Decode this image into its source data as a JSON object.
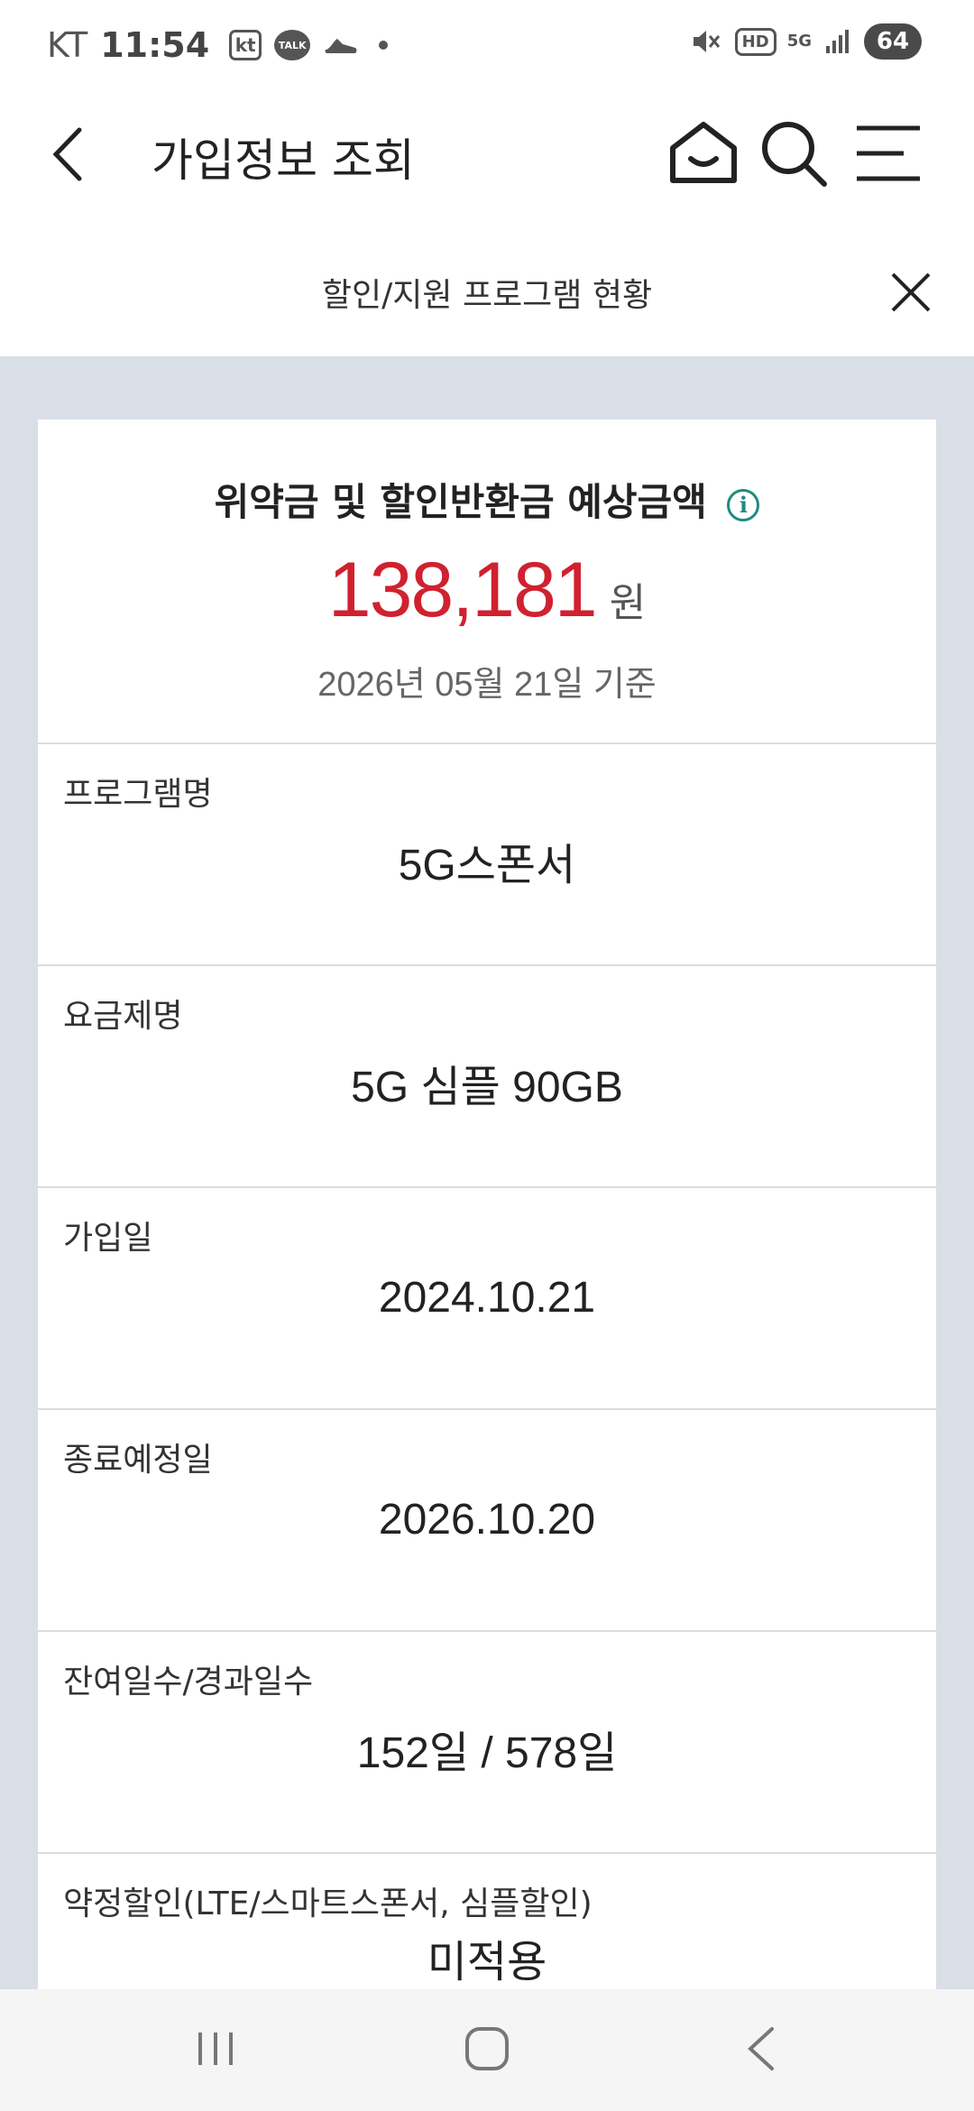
{
  "status_bar": {
    "carrier": "KT",
    "time": "11:54",
    "kt_badge": "kt",
    "talk_badge": "TALK",
    "hd_badge": "HD",
    "network": "5G",
    "battery": "64"
  },
  "header": {
    "title": "가입정보 조회"
  },
  "subheader": {
    "title": "할인/지원 프로그램 현황"
  },
  "summary": {
    "title": "위약금 및 할인반환금 예상금액",
    "info_icon": "i",
    "amount": "138,181",
    "unit": "원",
    "basis": "2026년 05월 21일 기준"
  },
  "rows": [
    {
      "label": "프로그램명",
      "value": "5G스폰서"
    },
    {
      "label": "요금제명",
      "value": "5G 심플 90GB"
    },
    {
      "label": "가입일",
      "value": "2024.10.21"
    },
    {
      "label": "종료예정일",
      "value": "2026.10.20"
    },
    {
      "label": "잔여일수/경과일수",
      "value": "152일 / 578일"
    },
    {
      "label": "약정할인(LTE/스마트스폰서, 심플할인)",
      "value": "미적용"
    }
  ],
  "colors": {
    "amount": "#d0212f",
    "info": "#1e8c7f",
    "background": "#d9dfe7"
  }
}
